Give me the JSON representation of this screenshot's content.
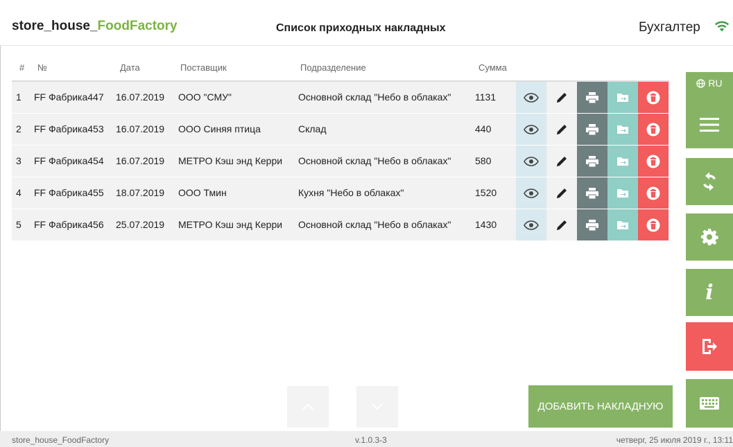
{
  "header": {
    "brand_prefix": "store_house_",
    "brand_suffix": "FoodFactory",
    "title": "Список приходных накладных",
    "user_role": "Бухгалтер",
    "wifi_icon": "wifi-icon"
  },
  "table": {
    "columns": [
      "#",
      "№",
      "Дата",
      "Поставщик",
      "Подразделение",
      "Сумма"
    ],
    "rows": [
      {
        "num": "1",
        "doc": "FF Фабрика447",
        "date": "16.07.2019",
        "supplier": "ООО \"СМУ\"",
        "division": "Основной склад \"Небо в облаках\"",
        "sum": "1131"
      },
      {
        "num": "2",
        "doc": "FF Фабрика453",
        "date": "16.07.2019",
        "supplier": "ООО Синяя птица",
        "division": "Склад",
        "sum": "440"
      },
      {
        "num": "3",
        "doc": "FF Фабрика454",
        "date": "16.07.2019",
        "supplier": "МЕТРО Кэш энд Керри",
        "division": "Основной склад \"Небо в облаках\"",
        "sum": "580"
      },
      {
        "num": "4",
        "doc": "FF Фабрика455",
        "date": "18.07.2019",
        "supplier": "ООО Тмин",
        "division": "Кухня \"Небо в облаках\"",
        "sum": "1520"
      },
      {
        "num": "5",
        "doc": "FF Фабрика456",
        "date": "25.07.2019",
        "supplier": "МЕТРО Кэш энд Керри",
        "division": "Основной склад \"Небо в облаках\"",
        "sum": "1430"
      }
    ],
    "row_actions": [
      "eye-icon",
      "pencil-icon",
      "printer-icon",
      "folder-export-icon",
      "trash-icon"
    ]
  },
  "sidebar": {
    "lang": "RU",
    "buttons": [
      "menu-icon",
      "sync-icon",
      "gear-icon",
      "info-icon",
      "logout-icon",
      "keyboard-icon"
    ],
    "info_glyph": "i"
  },
  "actions": {
    "add_label": "ДОБАВИТЬ НАКЛАДНУЮ"
  },
  "footer": {
    "left": "store_house_FoodFactory",
    "version": "v.1.0.3-3",
    "datetime": "четверг, 25 июля 2019 г., 13:11"
  },
  "colors": {
    "green": "#86b464",
    "brand_green": "#7cb342",
    "red": "#f25c5c",
    "teal": "#8fcfc6",
    "slate": "#6e7f80",
    "light_blue": "#d8e9ef"
  }
}
